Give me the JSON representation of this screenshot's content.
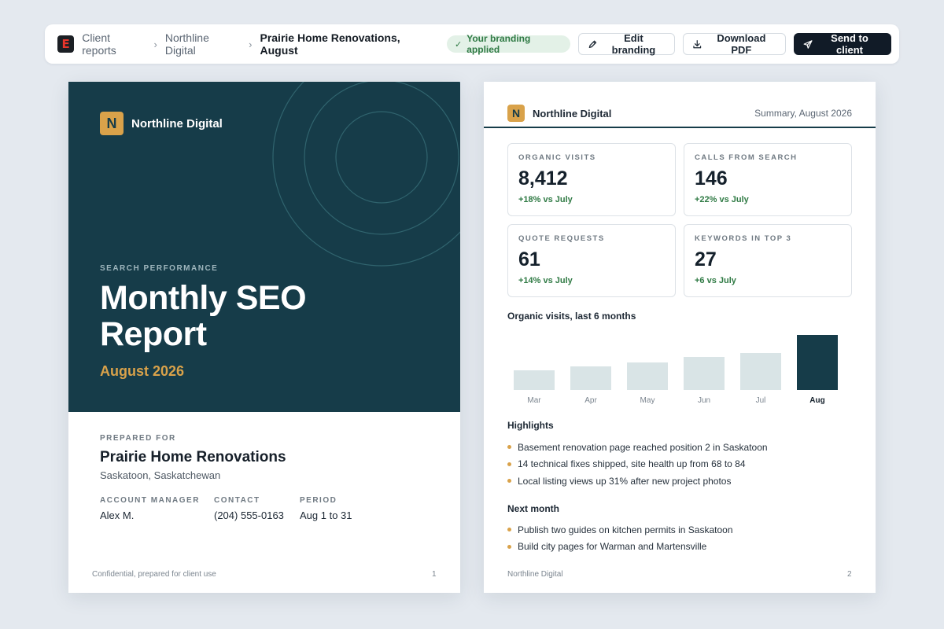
{
  "app": {
    "logo_letter": "E",
    "logo_color": "#e8352b"
  },
  "breadcrumb": [
    "Client reports",
    "Northline Digital",
    "Prairie Home Renovations, August"
  ],
  "status_badge": "Your branding applied",
  "toolbar": {
    "edit_label": "Edit branding",
    "download_label": "Download PDF",
    "send_label": "Send to client"
  },
  "colors": {
    "brand_dark": "#163c49",
    "brand_gold": "#d9a24a",
    "positive": "#2f7a44"
  },
  "page1": {
    "brand_letter": "N",
    "brand_name": "Northline Digital",
    "eyebrow": "SEARCH PERFORMANCE",
    "title": "Monthly SEO Report",
    "month": "August 2026",
    "prepared_label": "PREPARED FOR",
    "client_name": "Prairie Home Renovations",
    "client_location": "Saskatoon, Saskatchewan",
    "meta": [
      {
        "label": "ACCOUNT MANAGER",
        "value": "Alex M."
      },
      {
        "label": "CONTACT",
        "value": "(204) 555-0163"
      },
      {
        "label": "PERIOD",
        "value": "Aug 1 to 31"
      }
    ],
    "footer": "Confidential, prepared for client use",
    "page_number": "1"
  },
  "page2": {
    "brand_letter": "N",
    "brand_name": "Northline Digital",
    "summary_label": "Summary, August 2026",
    "kpis": [
      {
        "label": "ORGANIC VISITS",
        "value": "8,412",
        "delta": "+18% vs July"
      },
      {
        "label": "CALLS FROM SEARCH",
        "value": "146",
        "delta": "+22% vs July"
      },
      {
        "label": "QUOTE REQUESTS",
        "value": "61",
        "delta": "+14% vs July"
      },
      {
        "label": "KEYWORDS IN TOP 3",
        "value": "27",
        "delta": "+6 vs July"
      }
    ],
    "chart_title": "Organic visits, last 6 months",
    "highlights_title": "Highlights",
    "highlights": [
      "Basement renovation page reached position 2 in Saskatoon",
      "14 technical fixes shipped, site health up from 68 to 84",
      "Local listing views up 31% after new project photos"
    ],
    "next_title": "Next month",
    "next_items": [
      "Publish two guides on kitchen permits in Saskatoon",
      "Build city pages for Warman and Martensville"
    ],
    "footer": "Northline Digital",
    "page_number": "2"
  },
  "chart_data": {
    "type": "bar",
    "title": "Organic visits, last 6 months",
    "categories": [
      "Mar",
      "Apr",
      "May",
      "Jun",
      "Jul",
      "Aug"
    ],
    "values": [
      3000,
      3600,
      4200,
      5000,
      5600,
      8412
    ],
    "highlight_category": "Aug",
    "colors": {
      "base": "#d9e4e6",
      "highlight": "#163c49"
    }
  }
}
